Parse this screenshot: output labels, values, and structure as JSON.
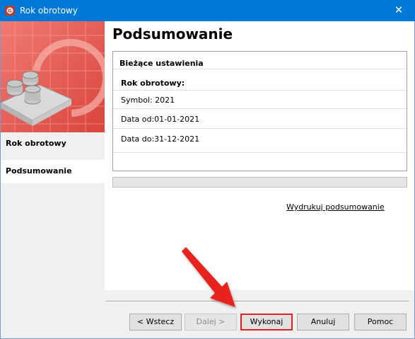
{
  "window": {
    "title": "Rok obrotowy",
    "close_glyph": "✕"
  },
  "sidebar": {
    "items": [
      {
        "label": "Rok obrotowy"
      },
      {
        "label": "Podsumowanie"
      }
    ]
  },
  "main": {
    "heading": "Podsumowanie",
    "summary": {
      "header": "Bieżące ustawienia",
      "section_label": "Rok obrotowy:",
      "symbol": "Symbol:  2021",
      "date_from": "Data od:01-01-2021",
      "date_to": "Data do:31-12-2021"
    },
    "print_link": "Wydrukuj podsumowanie"
  },
  "buttons": {
    "back": "< Wstecz",
    "next": "Dalej >",
    "execute": "Wykonaj",
    "cancel": "Anuluj",
    "help": "Pomoc"
  },
  "colors": {
    "titlebar": "#0078d7",
    "highlight": "#e02020",
    "banner": "#e5534b"
  }
}
